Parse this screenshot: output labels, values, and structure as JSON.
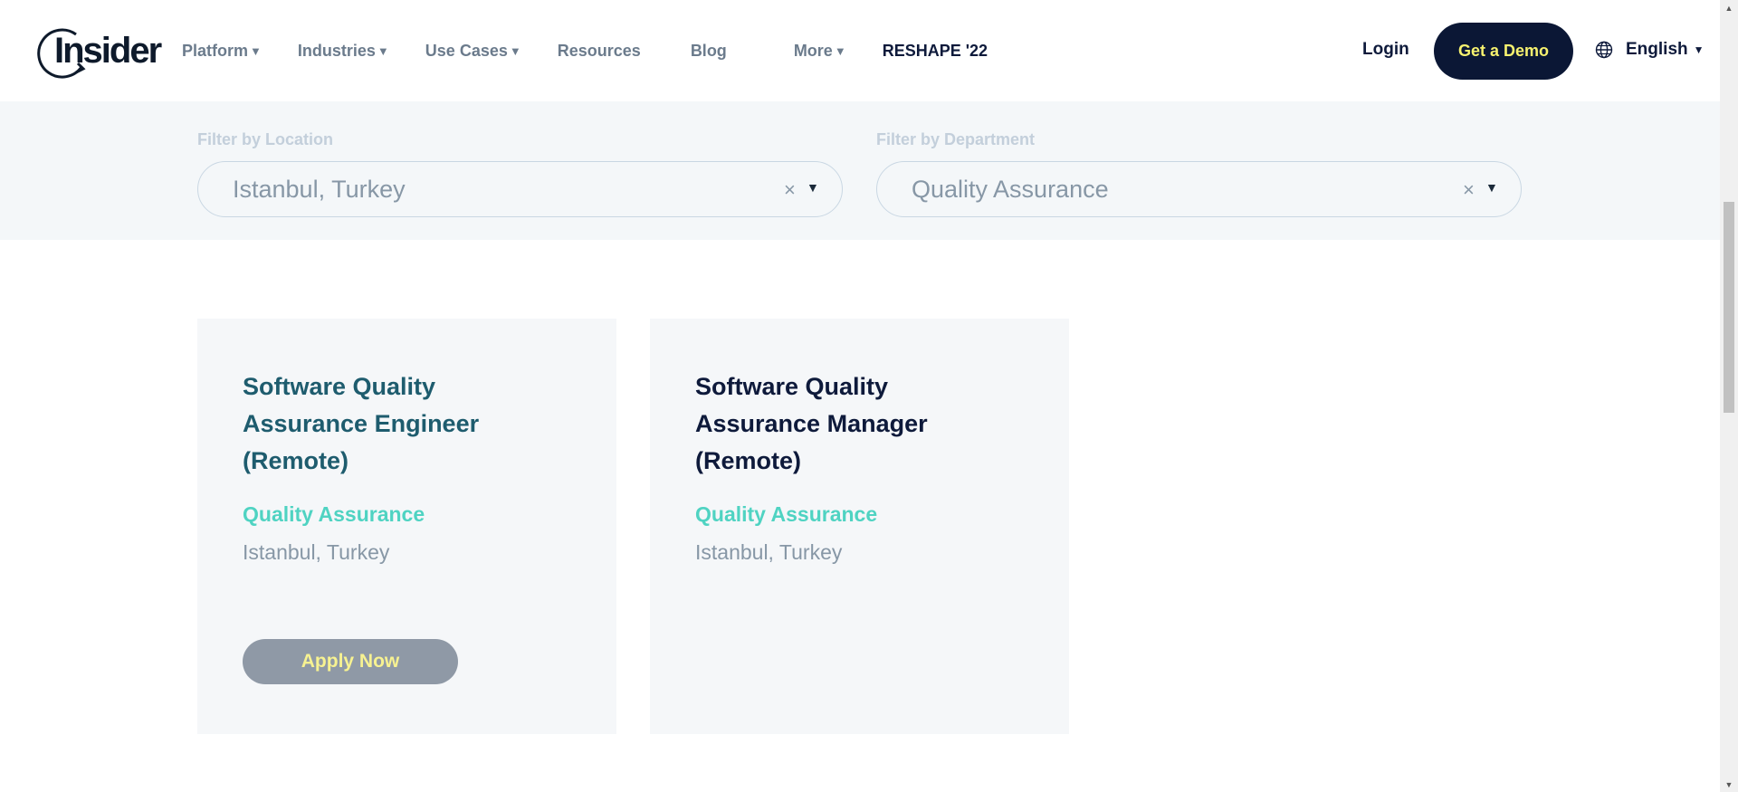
{
  "header": {
    "logo_text": "Insider",
    "nav": [
      {
        "label": "Platform",
        "has_caret": true
      },
      {
        "label": "Industries",
        "has_caret": true
      },
      {
        "label": "Use Cases",
        "has_caret": true
      },
      {
        "label": "Resources",
        "has_caret": false
      },
      {
        "label": "Blog",
        "has_caret": false
      },
      {
        "label": "More",
        "has_caret": true
      },
      {
        "label": "RESHAPE '22",
        "has_caret": false
      }
    ],
    "login_label": "Login",
    "demo_label": "Get a Demo",
    "language": "English",
    "caret_glyph": "▼"
  },
  "filters": {
    "location": {
      "label": "Filter by Location",
      "value": "Istanbul, Turkey",
      "clear": "×",
      "caret": "▼"
    },
    "department": {
      "label": "Filter by Department",
      "value": "Quality Assurance",
      "clear": "×",
      "caret": "▼"
    }
  },
  "jobs": [
    {
      "title": "Software Quality Assurance Engineer (Remote)",
      "department": "Quality Assurance",
      "location": "Istanbul, Turkey",
      "apply_label": "Apply Now",
      "title_color": "#1e5c6e"
    },
    {
      "title": "Software Quality Assurance Manager (Remote)",
      "department": "Quality Assurance",
      "location": "Istanbul, Turkey",
      "title_color": "#0e1a3b"
    }
  ],
  "colors": {
    "brand_dark": "#0b1735",
    "accent_yellow": "#f7f26f",
    "teal": "#4fd3c2"
  }
}
